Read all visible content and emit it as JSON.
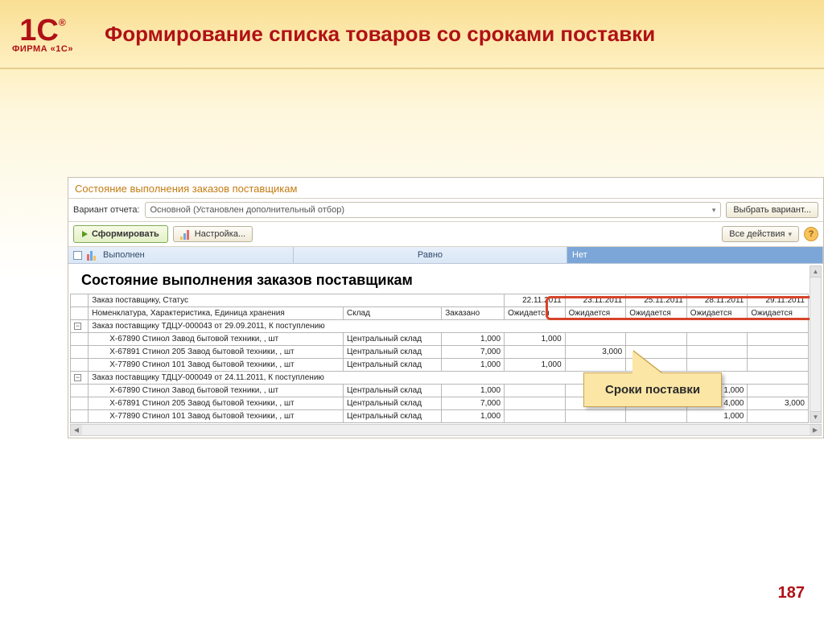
{
  "logo": {
    "mark": "1C",
    "reg": "®",
    "firm": "ФИРМА «1С»"
  },
  "slide_title": "Формирование списка товаров со сроками поставки",
  "page_number": "187",
  "window": {
    "caption": "Состояние выполнения заказов поставщикам",
    "variant_label": "Вариант отчета:",
    "variant_value": "Основной (Установлен дополнительный отбор)",
    "choose_variant": "Выбрать вариант...",
    "generate": "Сформировать",
    "settings": "Настройка...",
    "all_actions": "Все действия",
    "filter": {
      "field": "Выполнен",
      "compare": "Равно",
      "value": "Нет"
    }
  },
  "report": {
    "title": "Состояние выполнения заказов поставщикам",
    "hdr1": {
      "c1": "Заказ поставщику, Статус",
      "dates": [
        "22.11.2011",
        "23.11.2011",
        "25.11.2011",
        "28.11.2011",
        "29.11.2011"
      ]
    },
    "hdr2": {
      "c1": "Номенклатура, Характеристика, Единица хранения",
      "c2": "Склад",
      "c3": "Заказано",
      "exp": "Ожидается"
    },
    "g1": "Заказ поставщику ТДЦУ-000043 от 29.09.2011, К поступлению",
    "g2": "Заказ поставщику ТДЦУ-000049 от 24.11.2011, К поступлению",
    "wh": "Центральный склад",
    "rows1": [
      {
        "n": "X-67890 Стинол Завод бытовой техники, , шт",
        "o": "1,000",
        "d": [
          "1,000",
          "",
          "",
          "",
          ""
        ]
      },
      {
        "n": "X-67891 Стинол 205 Завод бытовой техники, , шт",
        "o": "7,000",
        "d": [
          "",
          "3,000",
          "",
          "",
          ""
        ]
      },
      {
        "n": "X-77890 Стинол 101 Завод бытовой техники, , шт",
        "o": "1,000",
        "d": [
          "1,000",
          "",
          "",
          "",
          ""
        ]
      }
    ],
    "rows2": [
      {
        "n": "X-67890 Стинол Завод бытовой техники, , шт",
        "o": "1,000",
        "d": [
          "",
          "",
          "",
          "1,000",
          ""
        ]
      },
      {
        "n": "X-67891 Стинол 205 Завод бытовой техники, , шт",
        "o": "7,000",
        "d": [
          "",
          "",
          "",
          "4,000",
          "3,000"
        ]
      },
      {
        "n": "X-77890 Стинол 101 Завод бытовой техники, , шт",
        "o": "1,000",
        "d": [
          "",
          "",
          "",
          "1,000",
          ""
        ]
      }
    ]
  },
  "callout": "Сроки поставки"
}
